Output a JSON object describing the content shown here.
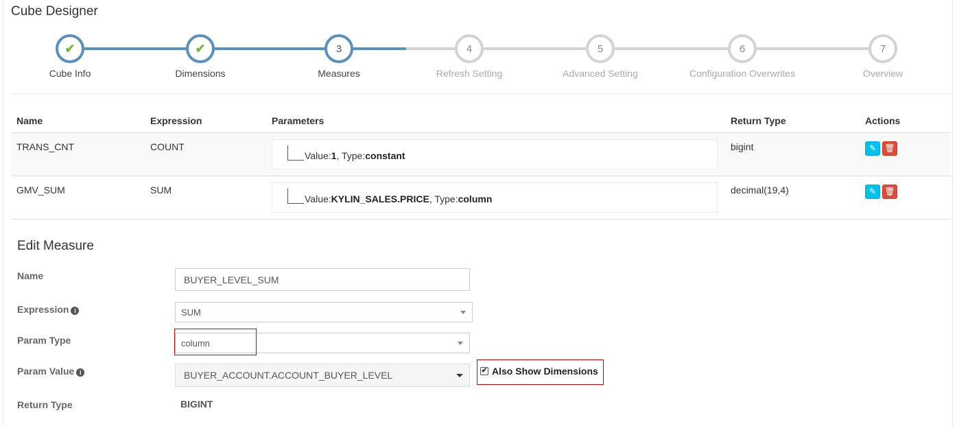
{
  "page": {
    "title": "Cube Designer"
  },
  "wizard": {
    "steps": [
      {
        "label": "Cube Info",
        "status": "done",
        "icon": "check-icon"
      },
      {
        "label": "Dimensions",
        "status": "done",
        "icon": "check-icon"
      },
      {
        "label": "Measures",
        "number": "3",
        "status": "active"
      },
      {
        "label": "Refresh Setting",
        "number": "4",
        "status": "todo"
      },
      {
        "label": "Advanced Setting",
        "number": "5",
        "status": "todo"
      },
      {
        "label": "Configuration Overwrites",
        "number": "6",
        "status": "todo"
      },
      {
        "label": "Overview",
        "number": "7",
        "status": "todo"
      }
    ],
    "colors": {
      "done": "#5b8fbe",
      "todo": "#d1d3d4",
      "check": "#7cb342"
    }
  },
  "table": {
    "headers": {
      "name": "Name",
      "expression": "Expression",
      "parameters": "Parameters",
      "return_type": "Return Type",
      "actions": "Actions"
    },
    "rows": [
      {
        "name": "TRANS_CNT",
        "expression": "COUNT",
        "value_label": "Value:",
        "value": "1",
        "type_label": ", Type:",
        "type": "constant",
        "return_type": "bigint"
      },
      {
        "name": "GMV_SUM",
        "expression": "SUM",
        "value_label": "Value:",
        "value": "KYLIN_SALES.PRICE",
        "type_label": ", Type:",
        "type": "column",
        "return_type": "decimal(19,4)"
      }
    ],
    "action_icons": [
      "pencil-icon",
      "trash-icon"
    ]
  },
  "edit_measure": {
    "title": "Edit Measure",
    "name_label": "Name",
    "name_value": "BUYER_LEVEL_SUM",
    "expression_label": "Expression",
    "expression_value": "SUM",
    "param_type_label": "Param Type",
    "param_type_value": "column",
    "param_value_label": "Param Value",
    "param_value_value": "BUYER_ACCOUNT.ACCOUNT_BUYER_LEVEL",
    "also_show_dimensions_label": "Also Show Dimensions",
    "also_show_dimensions_checked": true,
    "return_type_label": "Return Type",
    "return_type_value": "BIGINT",
    "info_icon": "info-icon"
  }
}
